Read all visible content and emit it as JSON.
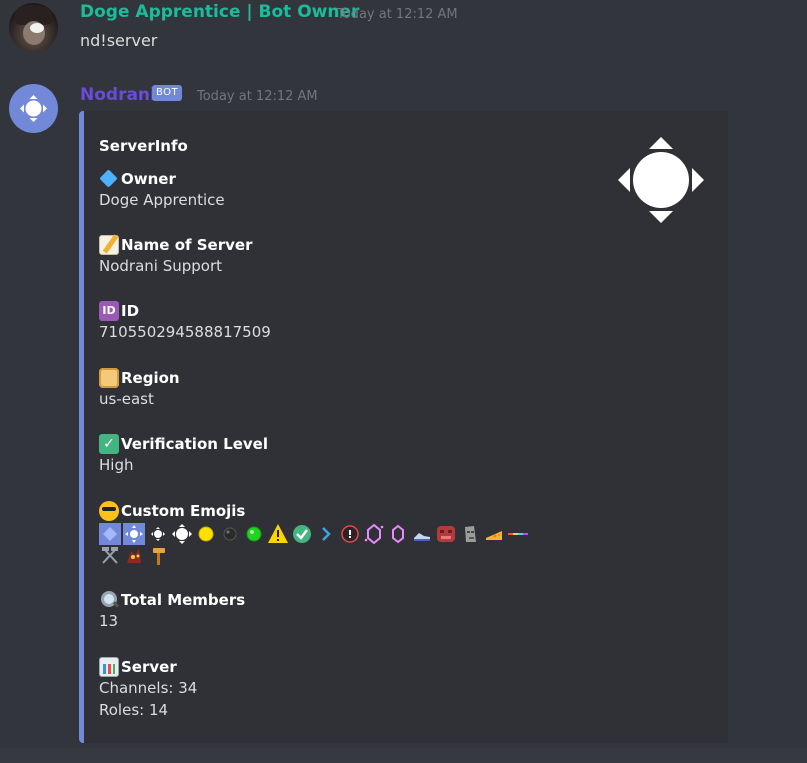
{
  "messages": [
    {
      "author": "Doge Apprentice | Bot Owner",
      "timestamp": "Today at 12:12 AM",
      "content": "nd!server"
    },
    {
      "author": "Nodrani",
      "tag": "BOT",
      "timestamp": "Today at 12:12 AM"
    }
  ],
  "embed": {
    "title": "ServerInfo",
    "accent_color": "#7289da",
    "fields": {
      "owner": {
        "icon": "gem-icon",
        "name": "Owner",
        "value": "Doge Apprentice"
      },
      "server_name": {
        "icon": "memo-icon",
        "name": "Name of Server",
        "value": "Nodrani Support"
      },
      "id": {
        "icon": "id-icon",
        "name": "ID",
        "value": "710550294588817509",
        "icon_text": "ID"
      },
      "region": {
        "icon": "scroll-icon",
        "name": "Region",
        "value": "us-east"
      },
      "verification": {
        "icon": "check-mark-icon",
        "name": "Verification Level",
        "value": "High",
        "icon_text": "✓"
      },
      "custom_emojis": {
        "icon": "cool-face-icon",
        "name": "Custom Emojis"
      },
      "total_members": {
        "icon": "magnifier-icon",
        "name": "Total Members",
        "value": "13"
      },
      "server": {
        "icon": "bar-chart-icon",
        "name": "Server",
        "channels": "Channels: 34",
        "roles": "Roles: 14"
      }
    }
  },
  "colors": {
    "background": "#36393f",
    "owner_name": "#1abc9c",
    "bot_name": "#6a4cd9",
    "bot_tag": "#7289da"
  }
}
